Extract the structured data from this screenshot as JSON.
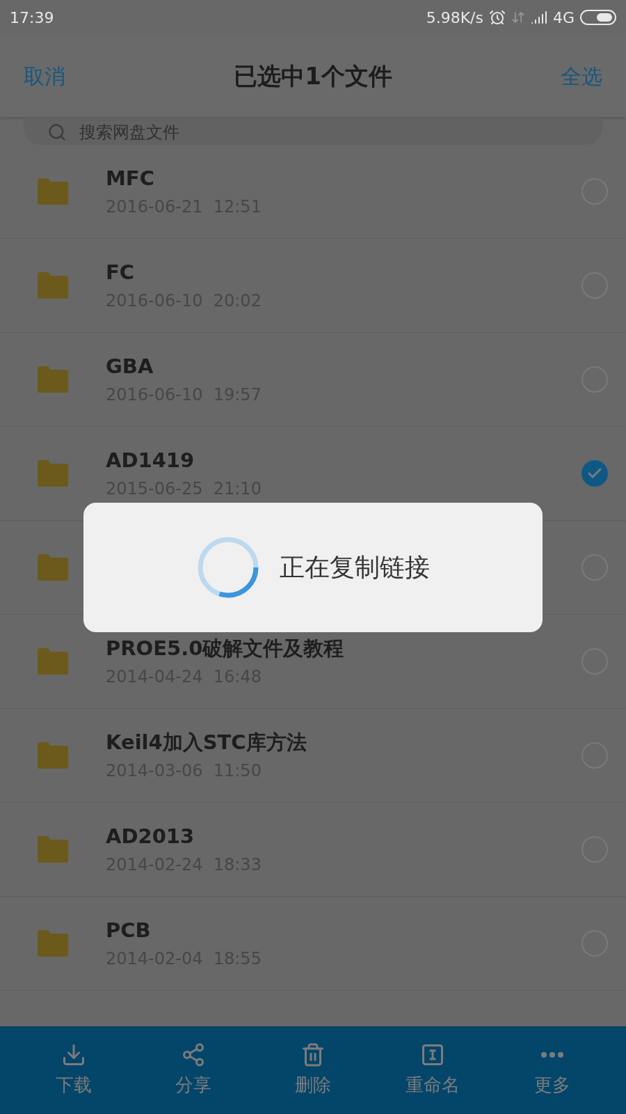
{
  "status_bar": {
    "time": "17:39",
    "speed": "5.98K/s",
    "network": "4G"
  },
  "header": {
    "cancel": "取消",
    "title": "已选中1个文件",
    "select_all": "全选"
  },
  "search": {
    "placeholder": "搜索网盘文件"
  },
  "files": [
    {
      "name": "MFC",
      "date": "2016-06-21  12:51",
      "selected": false
    },
    {
      "name": "FC",
      "date": "2016-06-10  20:02",
      "selected": false
    },
    {
      "name": "GBA",
      "date": "2016-06-10  19:57",
      "selected": false
    },
    {
      "name": "AD1419",
      "date": "2015-06-25  21:10",
      "selected": true
    },
    {
      "selected": false
    },
    {
      "name": "PROE5.0破解文件及教程",
      "date": "2014-04-24  16:48",
      "selected": false
    },
    {
      "name": "Keil4加入STC库方法",
      "date": "2014-03-06  11:50",
      "selected": false
    },
    {
      "name": "AD2013",
      "date": "2014-02-24  18:33",
      "selected": false
    },
    {
      "name": "PCB",
      "date": "2014-02-04  18:55",
      "selected": false
    }
  ],
  "dialog": {
    "message": "正在复制链接",
    "level": 0.3
  },
  "toolbar": [
    {
      "kind": "download",
      "label": "下载"
    },
    {
      "kind": "share",
      "label": "分享"
    },
    {
      "kind": "delete",
      "label": "删除"
    },
    {
      "kind": "rename",
      "label": "重命名"
    },
    {
      "kind": "more",
      "label": "更多"
    }
  ]
}
